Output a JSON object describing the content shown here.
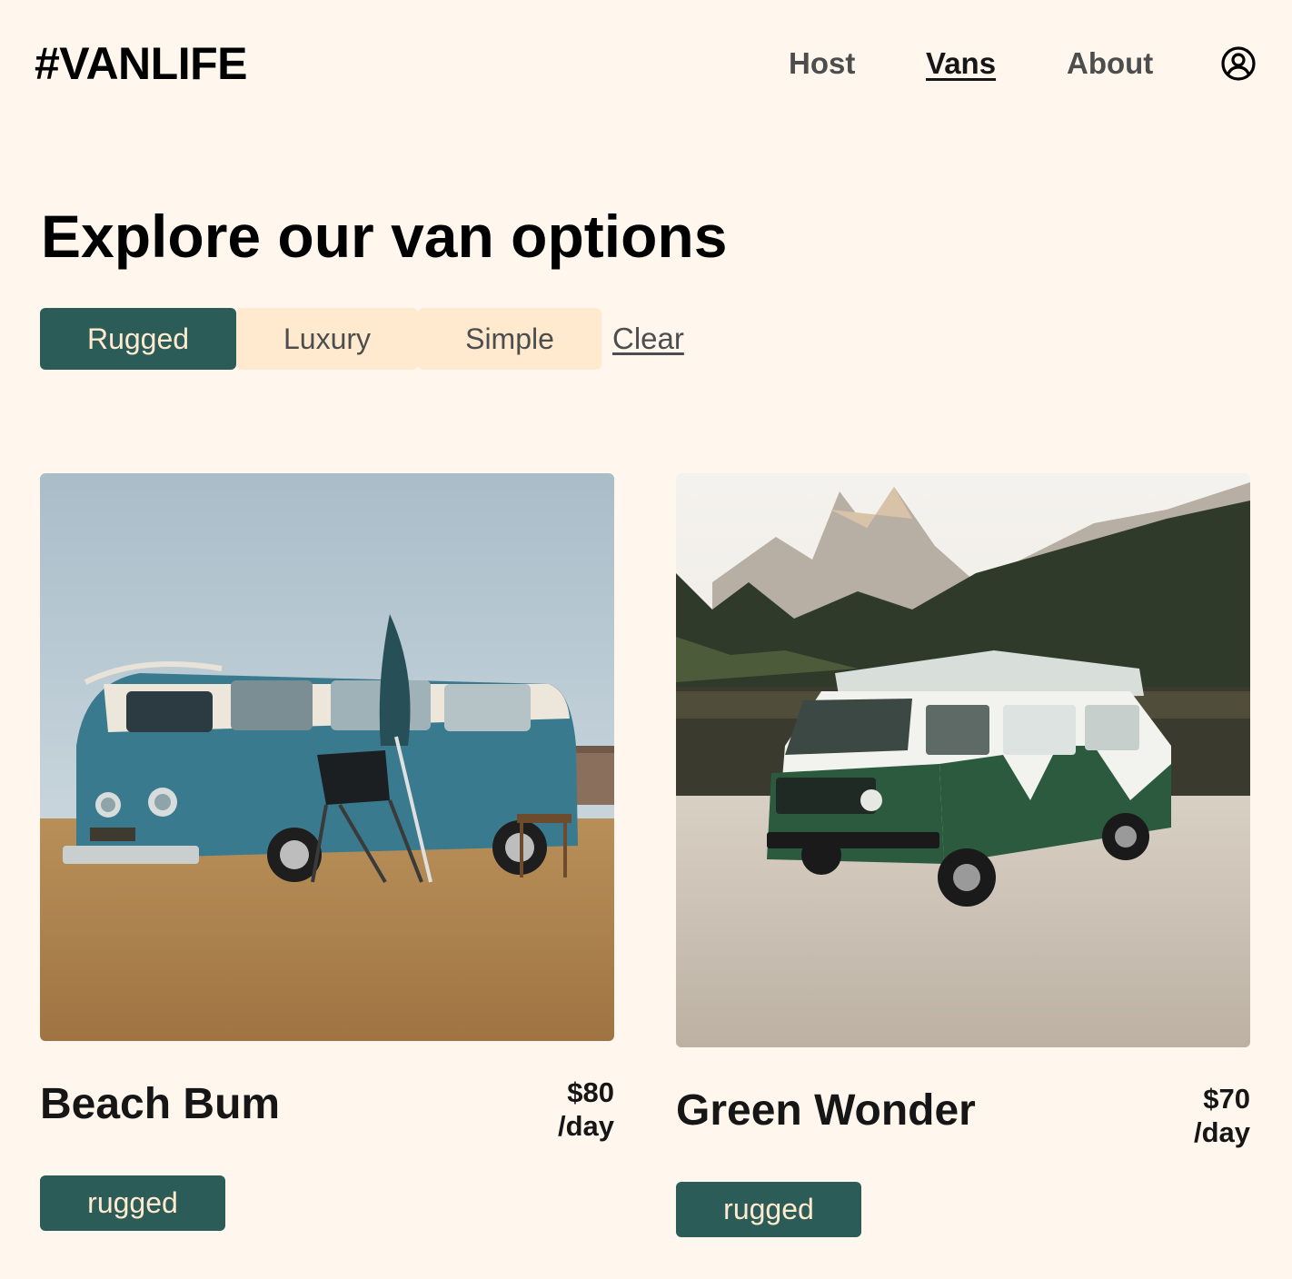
{
  "header": {
    "logo": "#VANLIFE",
    "nav": {
      "host": "Host",
      "vans": "Vans",
      "about": "About"
    },
    "account_icon": "user-circle-icon"
  },
  "main": {
    "title": "Explore our van options",
    "filters": {
      "rugged": "Rugged",
      "luxury": "Luxury",
      "simple": "Simple",
      "clear": "Clear",
      "active": "Rugged"
    },
    "vans": [
      {
        "name": "Beach Bum",
        "price": "$80",
        "per": "/day",
        "tag": "rugged",
        "image": "vintage-blue-white-bus-photo"
      },
      {
        "name": "Green Wonder",
        "price": "$70",
        "per": "/day",
        "tag": "rugged",
        "image": "green-white-camper-van-mountains-photo"
      }
    ]
  },
  "colors": {
    "background": "#FFF7ED",
    "accent": "#2B5C57",
    "filter_bg": "#FFEAD0",
    "nav_text": "#4D4D4D"
  }
}
